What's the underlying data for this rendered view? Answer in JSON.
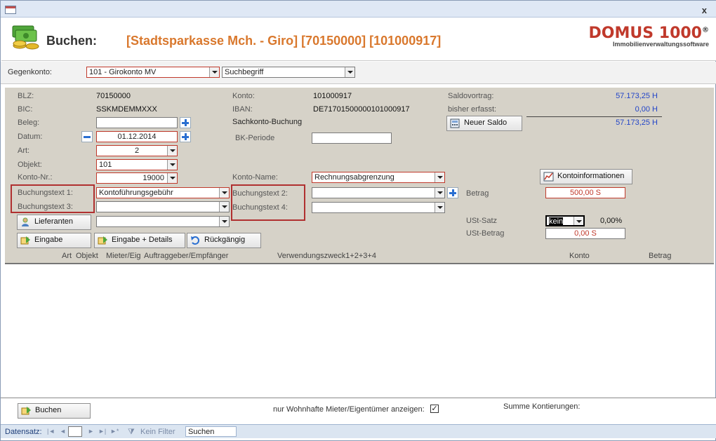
{
  "window": {
    "close_glyph": "x"
  },
  "header": {
    "title": "Buchen:",
    "account": "[Stadtsparkasse Mch. - Giro] [70150000] [101000917]",
    "logo_main": "DOMUS 1000",
    "logo_reg": "®",
    "logo_sub": "Immobilienverwaltungssoftware"
  },
  "gegenkonto": {
    "label": "Gegenkonto:",
    "value": "101 - Girokonto MV",
    "search_value": "Suchbegriff"
  },
  "info": {
    "blz_label": "BLZ:",
    "blz_value": "70150000",
    "bic_label": "BIC:",
    "bic_value": "SSKMDEMMXXX",
    "konto_label": "Konto:",
    "konto_value": "101000917",
    "iban_label": "IBAN:",
    "iban_value": "DE71701500000101000917",
    "saldovortrag_label": "Saldovortrag:",
    "saldovortrag_value": "57.173,25 H",
    "erfasst_label": "bisher erfasst:",
    "erfasst_value": "0,00 H",
    "saldo_total": "57.173,25 H",
    "sachkonto_label": "Sachkonto-Buchung",
    "bk_periode_label": "BK-Periode",
    "bk_periode_value": ""
  },
  "form": {
    "beleg_label": "Beleg:",
    "beleg_value": "",
    "datum_label": "Datum:",
    "datum_value": "01.12.2014",
    "art_label": "Art:",
    "art_value": "2",
    "objekt_label": "Objekt:",
    "objekt_value": "101",
    "kontonr_label": "Konto-Nr.:",
    "kontonr_value": "19000",
    "kontoname_label": "Konto-Name:",
    "kontoname_value": "Rechnungsabgrenzung",
    "bt1_label": "Buchungstext 1:",
    "bt1_value": "Kontoführungsgebühr",
    "bt2_label": "Buchungstext 2:",
    "bt2_value": "",
    "bt3_label": "Buchungstext 3:",
    "bt3_value": "",
    "bt4_label": "Buchungstext 4:",
    "bt4_value": "",
    "lieferanten_value": "",
    "betrag_label": "Betrag",
    "betrag_value": "500,00 S",
    "ust_satz_label": "USt-Satz",
    "ust_satz_value": "kein",
    "ust_satz_percent": "0,00%",
    "ust_betrag_label": "USt-Betrag",
    "ust_betrag_value": "0,00 S"
  },
  "buttons": {
    "neuer_saldo": "Neuer Saldo",
    "kontoinformationen": "Kontoinformationen",
    "lieferanten": "Lieferanten",
    "eingabe": "Eingabe",
    "eingabe_details": "Eingabe + Details",
    "rueckgaengig": "Rückgängig",
    "buchen": "Buchen"
  },
  "table": {
    "columns": [
      "Art",
      "Objekt",
      "Mieter/Eig",
      "Auftraggeber/Empfänger",
      "Verwendungszweck1+2+3+4",
      "Konto",
      "Betrag"
    ]
  },
  "footer": {
    "wohnhafte_label": "nur Wohnhafte Mieter/Eigentümer anzeigen:",
    "wohnhafte_checked": "✓",
    "summe_label": "Summe Kontierungen:"
  },
  "navbar": {
    "datensatz_label": "Datensatz:",
    "first": "|◄",
    "prev": "◄",
    "current": "",
    "next": "►",
    "last": "►|",
    "new": "►*",
    "filter_label": "Kein Filter",
    "search_label": "Suchen"
  },
  "colors": {
    "accent_orange": "#d9782d",
    "logo_red": "#c0392b",
    "saldo_blue": "#2345c8",
    "panel_bg": "#d6d2c8"
  }
}
